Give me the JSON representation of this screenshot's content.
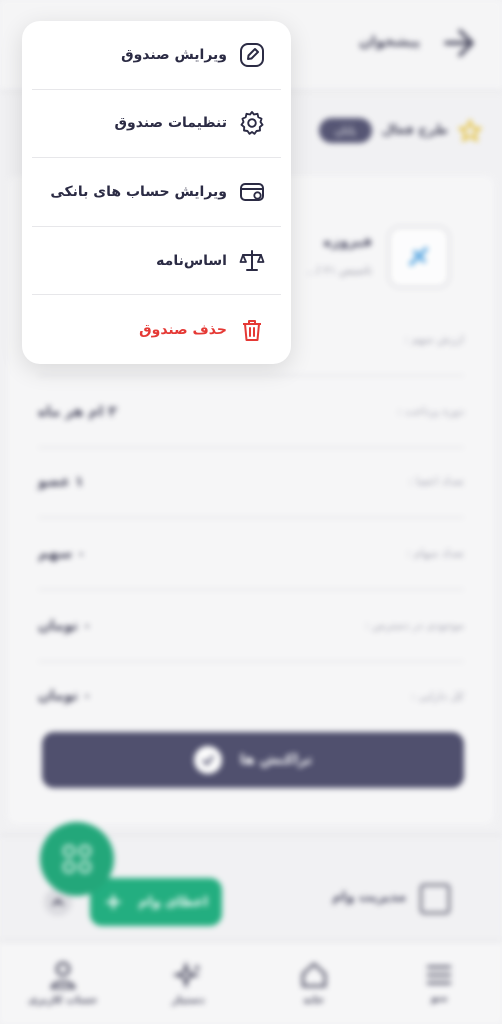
{
  "header": {
    "title": "پیشخوان"
  },
  "plan": {
    "label": "طرح فعال",
    "badge": "پایان"
  },
  "fund": {
    "name": "فیروزه",
    "subtitle": "تاسیس ۲۱ ا..."
  },
  "info": [
    {
      "label": "ارزش سهم :",
      "value": ""
    },
    {
      "label": "دوره پرداخت :",
      "value": "۳ ام هر ماه"
    },
    {
      "label": "تعداد اعضا :",
      "value": "۱ عضو"
    },
    {
      "label": "تعداد سهام :",
      "value": "۰ سهم"
    },
    {
      "label": "موجودی در دسترس :",
      "value": "۰ تومان"
    },
    {
      "label": "کل دارایی :",
      "value": "۰ تومان"
    }
  ],
  "transactions_button": "تراکنش ها",
  "loan": {
    "label": "مدیریت وام",
    "button": "اعطای وام"
  },
  "bottom_nav": [
    {
      "label": "منو",
      "icon": "hamburger-icon"
    },
    {
      "label": "خانه",
      "icon": "home-icon"
    },
    {
      "label": "دستیار",
      "icon": "sparkle-icon"
    },
    {
      "label": "حساب کاربری",
      "icon": "user-icon"
    }
  ],
  "menu": {
    "items": [
      {
        "label": "ویرایش صندوق",
        "icon": "edit-icon"
      },
      {
        "label": "تنظیمات صندوق",
        "icon": "gear-icon"
      },
      {
        "label": "ویرایش حساب های بانکی",
        "icon": "bank-card-icon"
      },
      {
        "label": "اساس‌نامه",
        "icon": "scale-icon"
      },
      {
        "label": "حذف صندوق",
        "icon": "trash-icon",
        "color": "#e53935"
      }
    ]
  }
}
